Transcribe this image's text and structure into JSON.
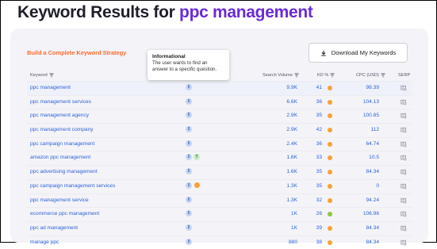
{
  "page": {
    "title_prefix": "Keyword Results for ",
    "title_keyword": "ppc management"
  },
  "toolbar": {
    "strategy_link": "Build a Complete Keyword Strategy",
    "download_label": "Download My Keywords"
  },
  "tooltip": {
    "title": "Informational",
    "body_line1": "The user wants to find an",
    "body_line2": "answer to a specific question."
  },
  "table": {
    "headers": {
      "keyword": "Keyword",
      "volume": "Search Volume",
      "kd": "KD %",
      "cpc": "CPC (USD)",
      "serp": "SERP"
    },
    "rows": [
      {
        "keyword": "ppc management",
        "intents": [
          "I"
        ],
        "volume": "9.9K",
        "kd": "41",
        "kd_color": "#f5a23a",
        "cpc": "98.39"
      },
      {
        "keyword": "ppc management services",
        "intents": [
          "I"
        ],
        "volume": "6.6K",
        "kd": "36",
        "kd_color": "#f5a23a",
        "cpc": "104.13"
      },
      {
        "keyword": "ppc management agency",
        "intents": [
          "I"
        ],
        "volume": "2.9K",
        "kd": "35",
        "kd_color": "#f5a23a",
        "cpc": "100.85"
      },
      {
        "keyword": "ppc management company",
        "intents": [
          "I"
        ],
        "volume": "2.9K",
        "kd": "42",
        "kd_color": "#f5a23a",
        "cpc": "112"
      },
      {
        "keyword": "ppc campaign management",
        "intents": [
          "I"
        ],
        "volume": "2.4K",
        "kd": "36",
        "kd_color": "#f5a23a",
        "cpc": "64.74"
      },
      {
        "keyword": "amazon ppc management",
        "intents": [
          "I",
          "T"
        ],
        "volume": "1.6K",
        "kd": "33",
        "kd_color": "#f5a23a",
        "cpc": "10.5"
      },
      {
        "keyword": "ppc advertising management",
        "intents": [
          "I"
        ],
        "volume": "1.6K",
        "kd": "35",
        "kd_color": "#f5a23a",
        "cpc": "84.34"
      },
      {
        "keyword": "ppc campaign management services",
        "intents": [
          "I",
          "C"
        ],
        "volume": "1.3K",
        "kd": "35",
        "kd_color": "#f5a23a",
        "cpc": "0"
      },
      {
        "keyword": "ppc management service",
        "intents": [
          "I"
        ],
        "volume": "1.3K",
        "kd": "32",
        "kd_color": "#f5a23a",
        "cpc": "94.24"
      },
      {
        "keyword": "ecommerce ppc management",
        "intents": [
          "I"
        ],
        "volume": "1K",
        "kd": "26",
        "kd_color": "#8cc63f",
        "cpc": "106.96"
      },
      {
        "keyword": "ppc ad management",
        "intents": [
          "I"
        ],
        "volume": "1K",
        "kd": "39",
        "kd_color": "#f5a23a",
        "cpc": "84.34"
      },
      {
        "keyword": "manage ppc",
        "intents": [
          "I"
        ],
        "volume": "880",
        "kd": "38",
        "kd_color": "#f5a23a",
        "cpc": "84.34"
      }
    ]
  },
  "icons": {
    "download": "download-icon",
    "filter": "filter-icon",
    "serp": "serp-icon",
    "informational": "informational-intent-icon",
    "transactional": "transactional-intent-icon",
    "commercial": "commercial-intent-icon"
  },
  "colors": {
    "title_keyword": "#6a2bd6",
    "link_blue": "#2e63d8",
    "accent_orange": "#ff6a2b",
    "kd_medium": "#f5a23a",
    "kd_easy": "#8cc63f"
  }
}
